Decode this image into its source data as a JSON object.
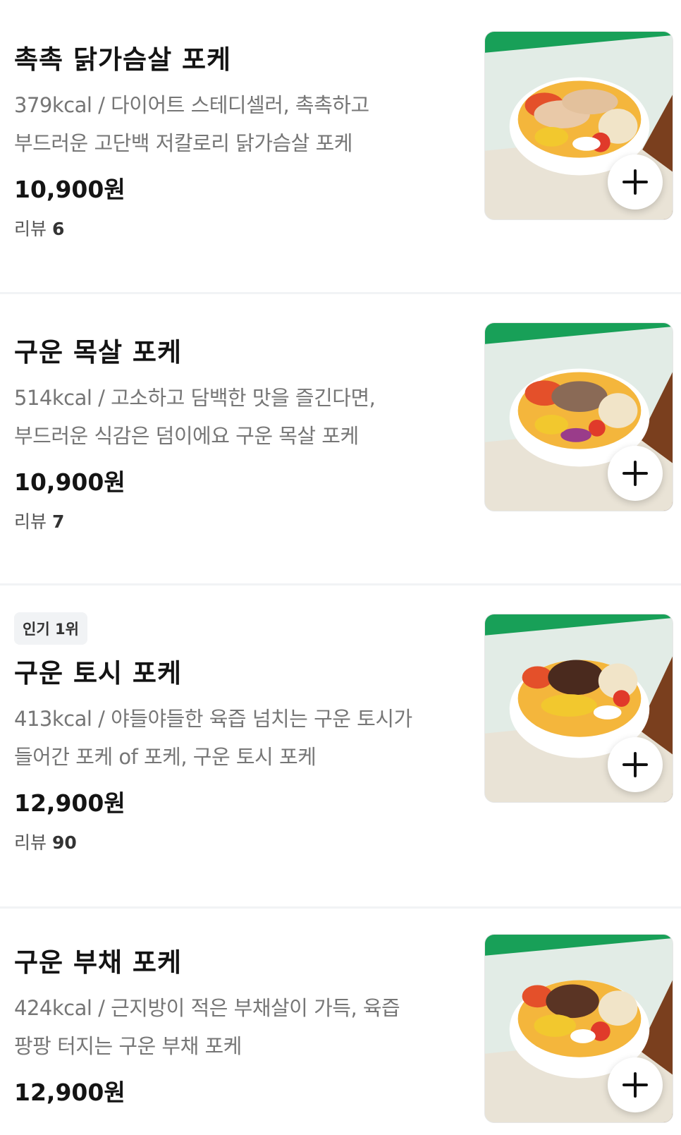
{
  "review_label": "리뷰",
  "colors": {
    "accent_green": "#18a058",
    "badge_bg": "#f1f3f5",
    "text_primary": "#141414",
    "text_secondary": "#767676"
  },
  "items": [
    {
      "name": "촉촉 닭가슴살 포케",
      "desc_line1": "379kcal / 다이어트 스테디셀러, 촉촉하고",
      "desc_line2": "부드러운 고단백 저칼로리 닭가슴살 포케",
      "price": "10,900원",
      "review_count": "6",
      "badge": "",
      "image_icon": "chicken-breast-poke-bowl",
      "add_icon": "plus-icon"
    },
    {
      "name": "구운 목살 포케",
      "desc_line1": "514kcal / 고소하고 담백한 맛을 즐긴다면,",
      "desc_line2": "부드러운 식감은 덤이에요 구운 목살 포케",
      "price": "10,900원",
      "review_count": "7",
      "badge": "",
      "image_icon": "pork-neck-poke-bowl",
      "add_icon": "plus-icon"
    },
    {
      "name": "구운 토시 포케",
      "desc_line1": "413kcal / 야들야들한 육즙 넘치는 구운 토시가",
      "desc_line2": "들어간 포케 of 포케, 구운 토시 포케",
      "price": "12,900원",
      "review_count": "90",
      "badge": "인기 1위",
      "image_icon": "hanger-steak-poke-bowl",
      "add_icon": "plus-icon"
    },
    {
      "name": "구운 부채 포케",
      "desc_line1": "424kcal / 근지방이 적은 부채살이 가득, 육즙",
      "desc_line2": "팡팡 터지는 구운 부채 포케",
      "price": "12,900원",
      "review_count": "",
      "badge": "",
      "image_icon": "flat-iron-poke-bowl",
      "add_icon": "plus-icon"
    }
  ]
}
